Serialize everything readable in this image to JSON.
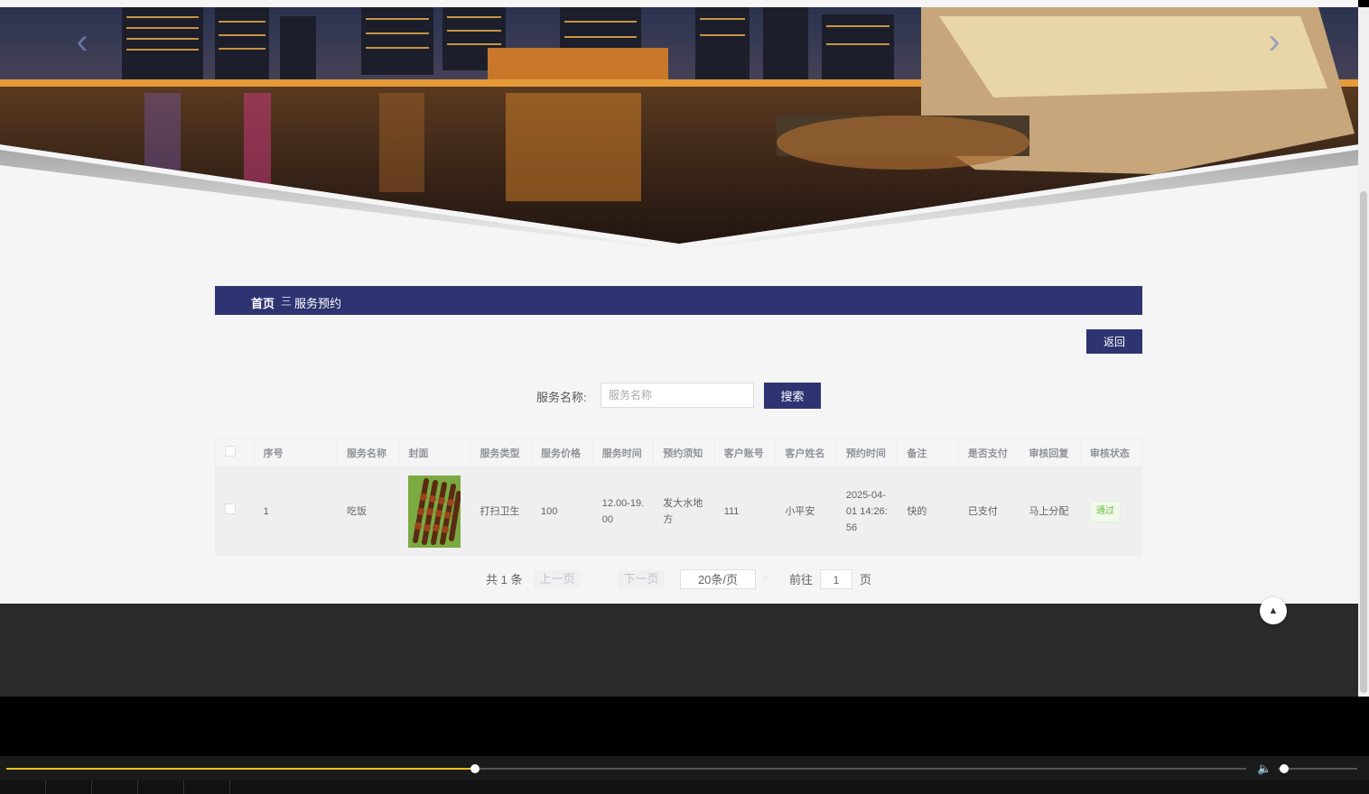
{
  "breadcrumb": {
    "home": "首页",
    "separator": "三",
    "current": "服务预约"
  },
  "actions": {
    "back_label": "返回"
  },
  "search": {
    "label": "服务名称:",
    "placeholder": "服务名称",
    "button_label": "搜索"
  },
  "table": {
    "headers": [
      "序号",
      "服务名称",
      "封面",
      "服务类型",
      "服务价格",
      "服务时间",
      "预约须知",
      "客户账号",
      "客户姓名",
      "预约时间",
      "备注",
      "是否支付",
      "审核回复",
      "审核状态"
    ],
    "rows": [
      {
        "index": "1",
        "service_name": "吃饭",
        "service_type": "打扫卫生",
        "price": "100",
        "service_time": "12.00-19.00",
        "notice": "发大水地方",
        "account": "111",
        "customer": "小平安",
        "booked_at": "2025-04-01 14:26:56",
        "remark": "快的",
        "paid": "已支付",
        "reply": "马上分配",
        "status": "通过"
      }
    ]
  },
  "pagination": {
    "total": "共 1 条",
    "prev": "上一页",
    "next": "下一页",
    "page_size": "20条/页",
    "goto": "前往",
    "page": "1",
    "page_unit": "页"
  },
  "video": {
    "progress": 0.378,
    "volume": 0.08
  },
  "colors": {
    "primary": "#2e3472",
    "success": "#67c23a",
    "footer": "#2a2a2a",
    "progress": "#e8c21a"
  }
}
